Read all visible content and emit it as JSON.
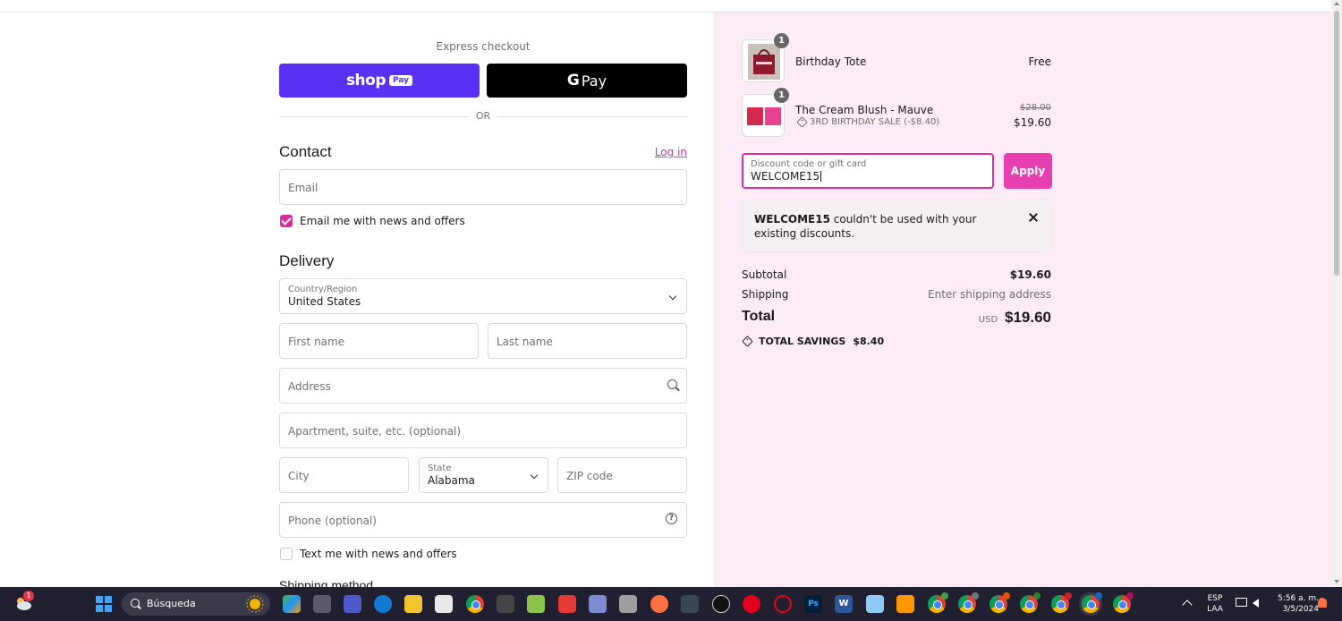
{
  "express": {
    "label": "Express checkout",
    "shop_pay_word": "shop",
    "shop_pay_pill": "Pay",
    "gpay_g": "G",
    "gpay_word": "Pay",
    "or": "OR"
  },
  "contact": {
    "title": "Contact",
    "login": "Log in",
    "email_placeholder": "Email",
    "news_checkbox": {
      "label": "Email me with news and offers",
      "checked": true
    }
  },
  "delivery": {
    "title": "Delivery",
    "country_label": "Country/Region",
    "country_value": "United States",
    "first_name_placeholder": "First name",
    "last_name_placeholder": "Last name",
    "address_placeholder": "Address",
    "apartment_placeholder": "Apartment, suite, etc. (optional)",
    "city_placeholder": "City",
    "state_label": "State",
    "state_value": "Alabama",
    "zip_placeholder": "ZIP code",
    "phone_placeholder": "Phone (optional)",
    "sms_checkbox": {
      "label": "Text me with news and offers",
      "checked": false
    },
    "shipping_method_title": "Shipping method"
  },
  "cart": {
    "items": [
      {
        "quantity": "1",
        "name": "Birthday Tote",
        "price": "Free"
      },
      {
        "quantity": "1",
        "name": "The Cream Blush - Mauve",
        "discount_label": "3RD BIRTHDAY SALE (-$8.40)",
        "original_price": "$28.00",
        "price": "$19.60"
      }
    ],
    "discount": {
      "label": "Discount code or gift card",
      "value": "WELCOME15",
      "apply": "Apply"
    },
    "error": {
      "code": "WELCOME15",
      "message": " couldn't be used with your existing discounts."
    },
    "summary": {
      "subtotal_label": "Subtotal",
      "subtotal_value": "$19.60",
      "shipping_label": "Shipping",
      "shipping_value": "Enter shipping address",
      "total_label": "Total",
      "total_currency": "USD",
      "total_value": "$19.60",
      "savings_label": "TOTAL SAVINGS",
      "savings_value": "$8.40"
    }
  },
  "taskbar": {
    "search_text": "Búsqueda",
    "weather_badge": "1",
    "language": "ESP",
    "language_sub": "LAA",
    "time": "5:56 a. m.",
    "date": "3/5/2024"
  },
  "colors": {
    "accent": "#d52fa0",
    "apply_button": "#e83fb0",
    "shop_pay": "#5a31f4",
    "sidebar_bg": "#fdebf7"
  }
}
